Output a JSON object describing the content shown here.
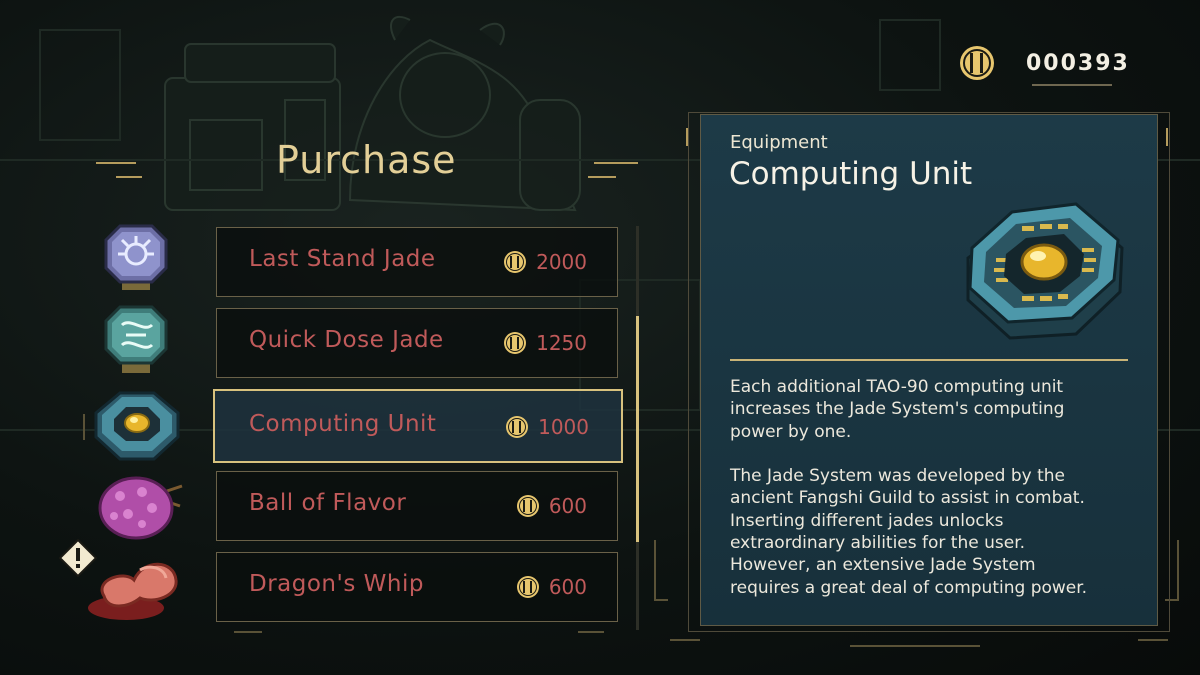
{
  "currency": {
    "icon": "jin-coin-icon",
    "amount": "000393"
  },
  "shop": {
    "title": "Purchase"
  },
  "items": [
    {
      "name": "Last Stand Jade",
      "price": "2000",
      "icon": "last-stand-jade-icon"
    },
    {
      "name": "Quick Dose Jade",
      "price": "1250",
      "icon": "quick-dose-jade-icon"
    },
    {
      "name": "Computing Unit",
      "price": "1000",
      "icon": "computing-unit-icon",
      "selected": true
    },
    {
      "name": "Ball of Flavor",
      "price": "600",
      "icon": "ball-of-flavor-icon"
    },
    {
      "name": "Dragon's Whip",
      "price": "600",
      "icon": "dragons-whip-icon",
      "badge": "warning-icon"
    }
  ],
  "detail": {
    "category": "Equipment",
    "name": "Computing Unit",
    "description": "Each additional TAO-90 computing unit\nincreases the Jade System's computing\npower by one.\n\nThe Jade System was developed by the\nancient Fangshi Guild to assist in combat.\nInserting different jades unlocks\nextraordinary abilities for the user.\nHowever, an extensive Jade System\nrequires a great deal of computing power."
  },
  "colors": {
    "accent_gold": "#d8c27e",
    "item_text": "#c05a5a",
    "panel_bg": "#1d3a47",
    "coin": "#e7c66e"
  }
}
